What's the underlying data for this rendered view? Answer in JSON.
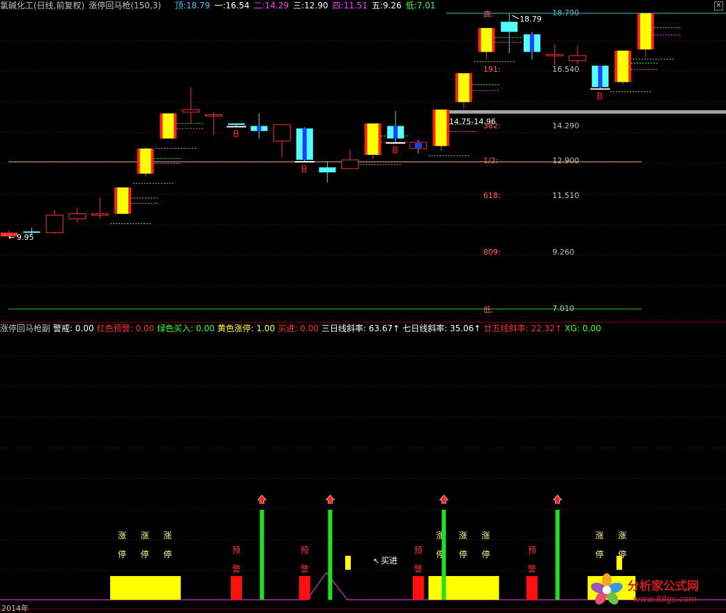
{
  "header": {
    "stock_title": "氯碱化工(日线,前复权)",
    "indicator_name": "涨停回马枪(150,3)",
    "levels": [
      {
        "label": "顶:",
        "value": "18.79",
        "color": "#40c0ff"
      },
      {
        "label": "一:",
        "value": "16.54",
        "color": "#ffffff"
      },
      {
        "label": "二:",
        "value": "14.29",
        "color": "#ff40ff"
      },
      {
        "label": "三:",
        "value": "12.90",
        "color": "#ffffff"
      },
      {
        "label": "四:",
        "value": "11.51",
        "color": "#ff40ff"
      },
      {
        "label": "五:",
        "value": "9.26",
        "color": "#ffffff"
      },
      {
        "label": "低:",
        "value": "7.01",
        "color": "#40ff40"
      }
    ],
    "close_glyph": "×"
  },
  "sub_header": {
    "name": "涨停回马枪副",
    "items": [
      {
        "label": "警戒: ",
        "value": "0.00",
        "color": "#ffffff"
      },
      {
        "label": "红色预警: ",
        "value": "0.00",
        "color": "#ff3030"
      },
      {
        "label": "绿色买入: ",
        "value": "0.00",
        "color": "#30ff30"
      },
      {
        "label": "黄色涨停: ",
        "value": "1.00",
        "color": "#ffff40"
      },
      {
        "label": "买进: ",
        "value": "0.00",
        "color": "#ff3030"
      },
      {
        "label": "三日线斜率: ",
        "value": "63.67↑",
        "color": "#ffffff"
      },
      {
        "label": "七日线斜率: ",
        "value": "35.06↑",
        "color": "#ffffff"
      },
      {
        "label": "廿五线斜率: ",
        "value": "22.32↑",
        "color": "#ff3030"
      },
      {
        "label": "XG: ",
        "value": "0.00",
        "color": "#30ff30"
      }
    ]
  },
  "annotations": {
    "high_price": "18.79",
    "low_price": "9.95",
    "box_range": "14.75-14.96",
    "buy_marker": "B",
    "buy_text": "买进",
    "limit_up_chars": [
      "涨",
      "停"
    ],
    "warning_chars": [
      "预",
      "警"
    ],
    "bottom_year": "2014年"
  },
  "fib_levels": [
    {
      "tag": "高:",
      "value": "18.790",
      "tag_color": "#ff6060",
      "value_color": "#40c0c0"
    },
    {
      "tag": "191:",
      "value": "16.540",
      "tag_color": "#ff6060",
      "value_color": "#c0c0c0"
    },
    {
      "tag": "382:",
      "value": "14.290",
      "tag_color": "#ff6060",
      "value_color": "#c0c0c0"
    },
    {
      "tag": "1/2:",
      "value": "12.900",
      "tag_color": "#ff6060",
      "value_color": "#c0c0c0"
    },
    {
      "tag": "618:",
      "value": "11.510",
      "tag_color": "#ff6060",
      "value_color": "#c0c0c0"
    },
    {
      "tag": "809:",
      "value": "9.260",
      "tag_color": "#ff6060",
      "value_color": "#c0c0c0"
    },
    {
      "tag": "低:",
      "value": "7.010",
      "tag_color": "#ff6060",
      "value_color": "#c0c0c0"
    }
  ],
  "candles": [
    {
      "o": 10.05,
      "c": 9.9,
      "h": 10.15,
      "l": 9.85,
      "kind": "down-red"
    },
    {
      "o": 10.1,
      "c": 10.05,
      "h": 10.25,
      "l": 9.95,
      "kind": "cyan"
    },
    {
      "o": 10.05,
      "c": 10.75,
      "h": 10.95,
      "l": 10.0,
      "kind": "up-hollow"
    },
    {
      "o": 10.6,
      "c": 10.8,
      "h": 11.05,
      "l": 10.45,
      "kind": "up-hollow"
    },
    {
      "o": 10.75,
      "c": 10.8,
      "h": 11.45,
      "l": 10.6,
      "kind": "up-hollow"
    },
    {
      "o": 10.8,
      "c": 11.85,
      "h": 11.85,
      "l": 10.8,
      "kind": "limit"
    },
    {
      "o": 12.4,
      "c": 13.4,
      "h": 13.45,
      "l": 12.3,
      "kind": "limit"
    },
    {
      "o": 13.8,
      "c": 14.8,
      "h": 14.8,
      "l": 13.8,
      "kind": "limit"
    },
    {
      "o": 14.85,
      "c": 14.95,
      "h": 15.85,
      "l": 14.4,
      "kind": "up-hollow"
    },
    {
      "o": 14.7,
      "c": 14.75,
      "h": 14.85,
      "l": 13.95,
      "kind": "up-hollow"
    },
    {
      "o": 14.35,
      "c": 14.4,
      "h": 14.4,
      "l": 14.3,
      "kind": "cyan"
    },
    {
      "o": 14.3,
      "c": 14.1,
      "h": 14.8,
      "l": 13.8,
      "kind": "cyan-blue"
    },
    {
      "o": 13.7,
      "c": 14.35,
      "h": 14.35,
      "l": 13.05,
      "kind": "up-hollow"
    },
    {
      "o": 14.2,
      "c": 12.95,
      "h": 14.25,
      "l": 12.9,
      "kind": "cyan-blue"
    },
    {
      "o": 12.65,
      "c": 12.45,
      "h": 12.9,
      "l": 12.05,
      "kind": "cyan"
    },
    {
      "o": 12.6,
      "c": 12.95,
      "h": 13.35,
      "l": 12.6,
      "kind": "up-hollow"
    },
    {
      "o": 13.15,
      "c": 14.4,
      "h": 14.4,
      "l": 13.0,
      "kind": "limit"
    },
    {
      "o": 14.3,
      "c": 13.8,
      "h": 14.9,
      "l": 13.65,
      "kind": "cyan-blue"
    },
    {
      "o": 13.4,
      "c": 13.65,
      "h": 13.75,
      "l": 13.2,
      "kind": "blue-small"
    },
    {
      "o": 13.5,
      "c": 14.95,
      "h": 14.95,
      "l": 13.3,
      "kind": "limit"
    },
    {
      "o": 15.25,
      "c": 16.4,
      "h": 16.4,
      "l": 15.0,
      "kind": "limit"
    },
    {
      "o": 17.25,
      "c": 18.2,
      "h": 18.2,
      "l": 16.95,
      "kind": "limit"
    },
    {
      "o": 18.45,
      "c": 18.05,
      "h": 18.79,
      "l": 17.2,
      "kind": "cyan"
    },
    {
      "o": 17.95,
      "c": 17.25,
      "h": 18.05,
      "l": 16.95,
      "kind": "cyan-blue"
    },
    {
      "o": 17.1,
      "c": 17.15,
      "h": 17.55,
      "l": 16.75,
      "kind": "up-hollow"
    },
    {
      "o": 16.9,
      "c": 17.1,
      "h": 17.5,
      "l": 16.75,
      "kind": "up-hollow"
    },
    {
      "o": 16.7,
      "c": 15.85,
      "h": 16.7,
      "l": 15.8,
      "kind": "cyan-blue"
    },
    {
      "o": 16.05,
      "c": 17.3,
      "h": 17.3,
      "l": 15.95,
      "kind": "limit"
    },
    {
      "o": 17.35,
      "c": 18.79,
      "h": 18.79,
      "l": 17.05,
      "kind": "limit"
    }
  ],
  "buy_signals": [
    10,
    13,
    17,
    26
  ],
  "sub_signals": {
    "limit_up_bars": [
      5,
      6,
      7,
      19,
      20,
      21,
      26,
      27
    ],
    "warning_bars": [
      10,
      13,
      18,
      23
    ],
    "buy_arrows": [
      11,
      14,
      19,
      24
    ]
  }
}
